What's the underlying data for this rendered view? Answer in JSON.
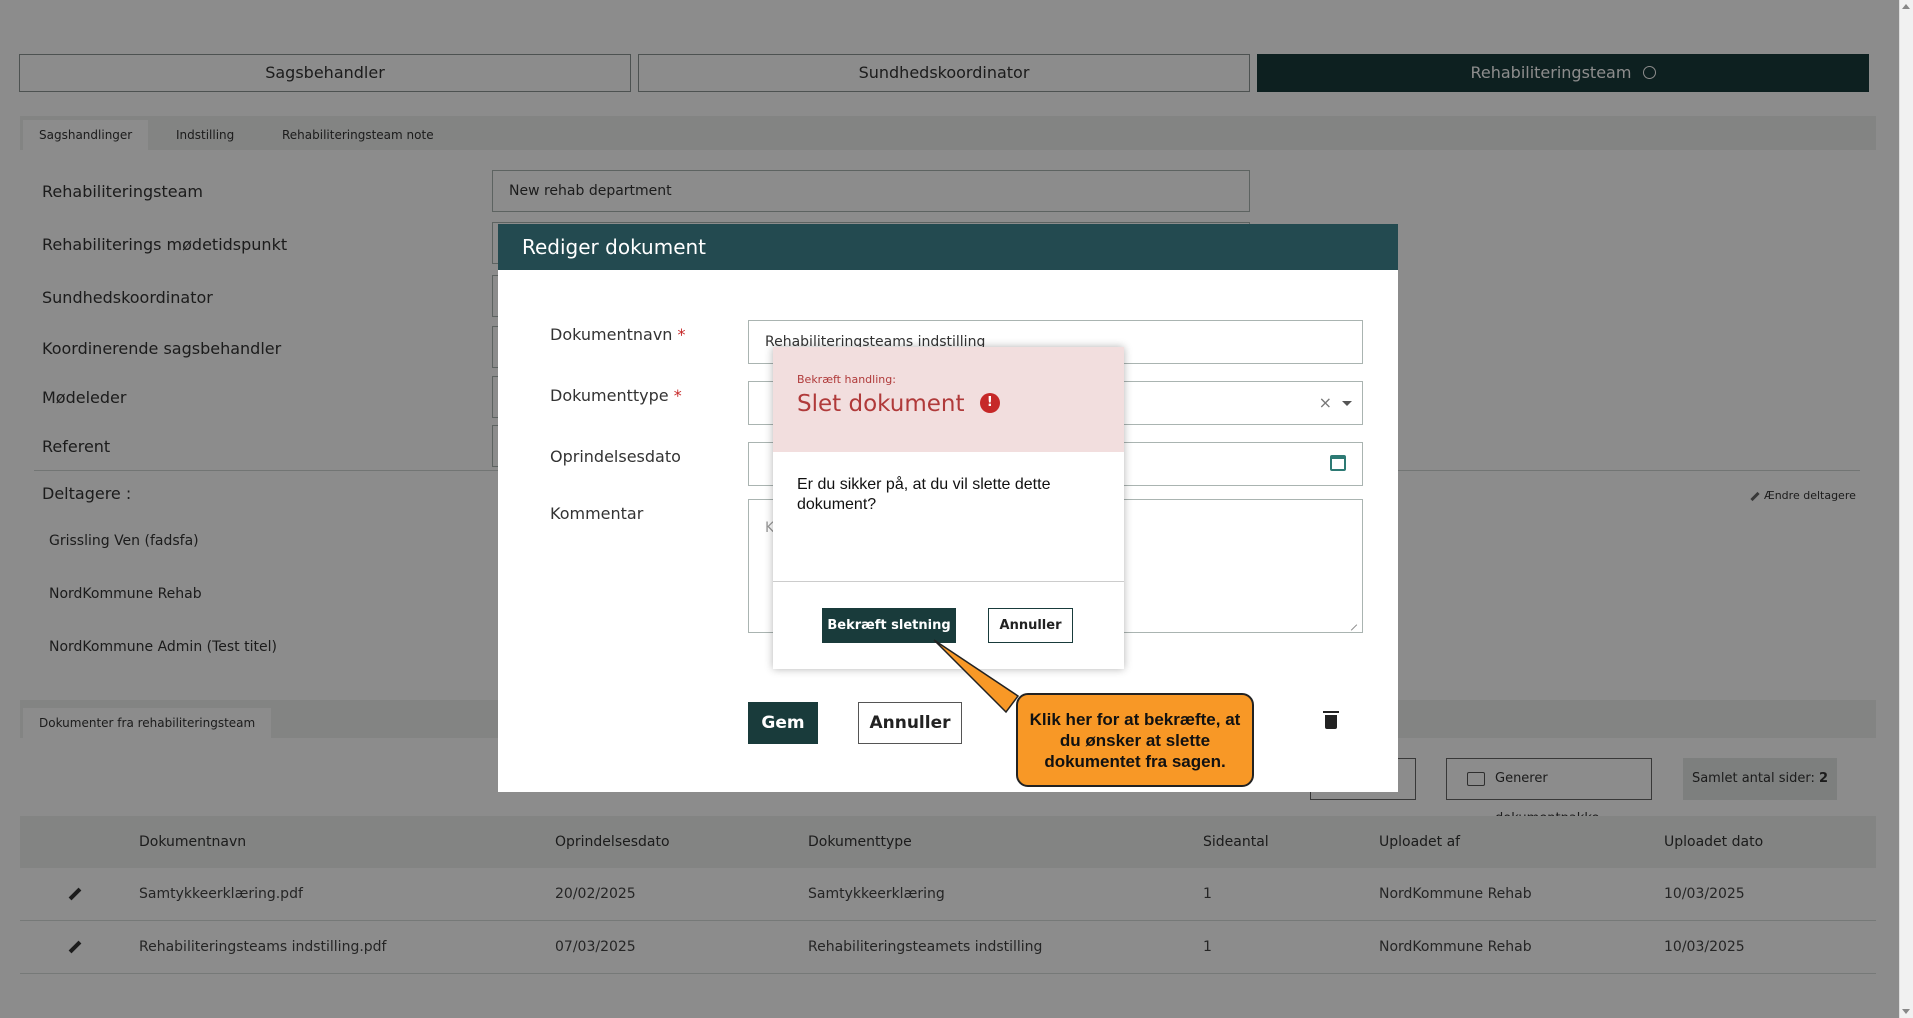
{
  "roles": {
    "sagsbehandler": "Sagsbehandler",
    "sundhedskoordinator": "Sundhedskoordinator",
    "rehabiliteringsteam": "Rehabiliteringsteam"
  },
  "tabs": [
    "Sagshandlinger",
    "Indstilling",
    "Rehabiliteringsteam note"
  ],
  "fields": {
    "rehabiliteringsteam_label": "Rehabiliteringsteam",
    "rehabiliteringsteam_value": "New rehab department",
    "modetidspunkt_label": "Rehabiliterings mødetidspunkt",
    "sundhedskoordinator_label": "Sundhedskoordinator",
    "koordinerende_label": "Koordinerende sagsbehandler",
    "modeleder_label": "Mødeleder",
    "referent_label": "Referent"
  },
  "participants": {
    "heading": "Deltagere :",
    "edit_label": "Ændre deltagere",
    "items": [
      "Grissling Ven (fadsfa)",
      "NordKommune Rehab",
      "NordKommune Admin (Test titel)"
    ]
  },
  "documents": {
    "tab_label": "Dokumenter fra rehabiliteringsteam",
    "generate_label": "Generer dokumentpakke",
    "total_pages_label": "Samlet antal sider:",
    "total_pages_value": "2",
    "columns": [
      "Dokumentnavn",
      "Oprindelsesdato",
      "Dokumenttype",
      "Sideantal",
      "Uploadet af",
      "Uploadet dato"
    ],
    "rows": [
      [
        "Samtykkeerklæring.pdf",
        "20/02/2025",
        "Samtykkeerklæring",
        "1",
        "NordKommune Rehab",
        "10/03/2025"
      ],
      [
        "Rehabiliteringsteams indstilling.pdf",
        "07/03/2025",
        "Rehabiliteringsteamets indstilling",
        "1",
        "NordKommune Rehab",
        "10/03/2025"
      ]
    ]
  },
  "modal": {
    "title": "Rediger dokument",
    "name_label": "Dokumentnavn",
    "name_value": "Rehabiliteringsteams indstilling",
    "type_label": "Dokumenttype",
    "date_label": "Oprindelsesdato",
    "comment_label": "Kommentar",
    "comment_placeholder_char": "K",
    "required_mark": "*",
    "clear_glyph": "×",
    "save_label": "Gem",
    "cancel_label": "Annuller"
  },
  "confirm": {
    "kicker": "Bekræft handling:",
    "title": "Slet dokument",
    "alert_glyph": "!",
    "message": "Er du sikker på, at du vil slette dette dokument?",
    "confirm_label": "Bekræft sletning",
    "cancel_label": "Annuller"
  },
  "callout": {
    "text": "Klik her for at bekræfte, at du ønsker at slette dokumentet fra sagen."
  },
  "colors": {
    "primary_dark": "#193b3b",
    "modal_header": "#234a50",
    "danger": "#b03a3a",
    "callout": "#f89826"
  }
}
